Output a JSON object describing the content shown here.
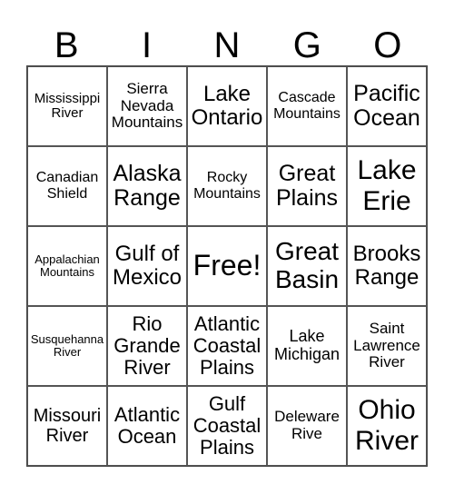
{
  "header": [
    "B",
    "I",
    "N",
    "G",
    "O"
  ],
  "rows": [
    [
      "Mississippi River",
      "Sierra Nevada Mountains",
      "Lake Ontario",
      "Cascade Mountains",
      "Pacific Ocean"
    ],
    [
      "Canadian Shield",
      "Alaska Range",
      "Rocky Mountains",
      "Great Plains",
      "Lake Erie"
    ],
    [
      "Appalachian Mountains",
      "Gulf of Mexico",
      "Free!",
      "Great Basin",
      "Brooks Range"
    ],
    [
      "Susquehanna River",
      "Rio Grande River",
      "Atlantic Coastal Plains",
      "Lake Michigan",
      "Saint Lawrence River"
    ],
    [
      "Missouri River",
      "Atlantic Ocean",
      "Gulf Coastal Plains",
      "Deleware Rive",
      "Ohio River"
    ]
  ]
}
